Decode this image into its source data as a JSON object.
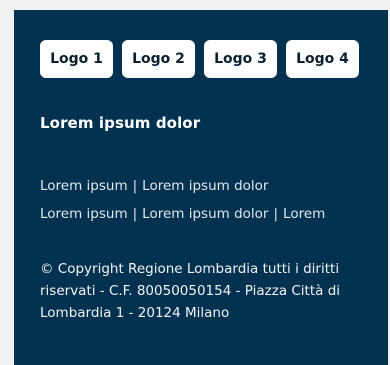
{
  "logos": [
    "Logo 1",
    "Logo 2",
    "Logo 3",
    "Logo 4"
  ],
  "footer": {
    "title": "Lorem ipsum dolor",
    "links_row1": [
      "Lorem ipsum",
      "Lorem ipsum dolor"
    ],
    "links_row2": [
      "Lorem ipsum",
      "Lorem ipsum dolor",
      "Lorem"
    ],
    "separator": "|",
    "copyright": "© Copyright Regione Lombardia tutti i diritti riservati - C.F. 80050050154 - Piazza Città di Lombardia 1 - 20124 Milano"
  },
  "colors": {
    "footer_bg": "#033150",
    "page_bg": "#f0f1f2",
    "button_bg": "#ffffff"
  }
}
